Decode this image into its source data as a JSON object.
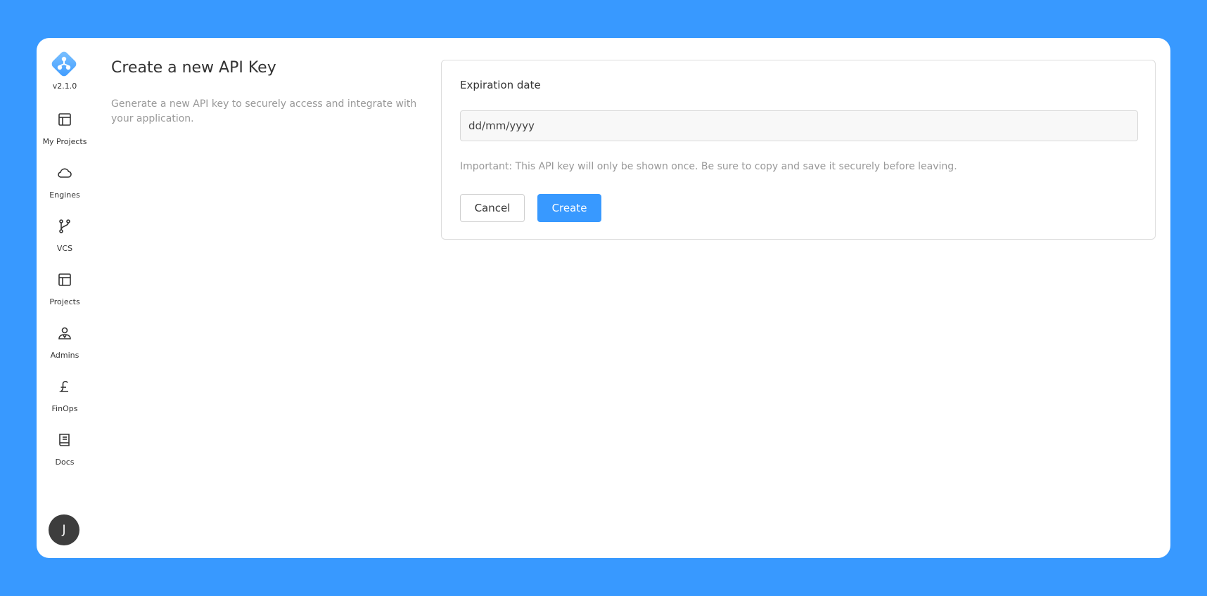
{
  "app": {
    "version": "v2.1.0",
    "user_initial": "J"
  },
  "sidebar": {
    "items": [
      {
        "label": "My Projects",
        "icon": "layout-icon"
      },
      {
        "label": "Engines",
        "icon": "cloud-icon"
      },
      {
        "label": "VCS",
        "icon": "git-branch-icon"
      },
      {
        "label": "Projects",
        "icon": "layout-icon"
      },
      {
        "label": "Admins",
        "icon": "user-badge-icon"
      },
      {
        "label": "FinOps",
        "icon": "pound-icon"
      },
      {
        "label": "Docs",
        "icon": "book-icon"
      }
    ]
  },
  "page": {
    "title": "Create a new API Key",
    "description": "Generate a new API key to securely access and integrate with your application."
  },
  "form": {
    "expiration_label": "Expiration date",
    "expiration_placeholder": "dd/mm/yyyy",
    "notice": "Important: This API key will only be shown once. Be sure to copy and save it securely before leaving.",
    "cancel_label": "Cancel",
    "create_label": "Create"
  },
  "colors": {
    "background": "#3899ff",
    "accent": "#3899ff",
    "avatar": "#3d3d3d"
  }
}
